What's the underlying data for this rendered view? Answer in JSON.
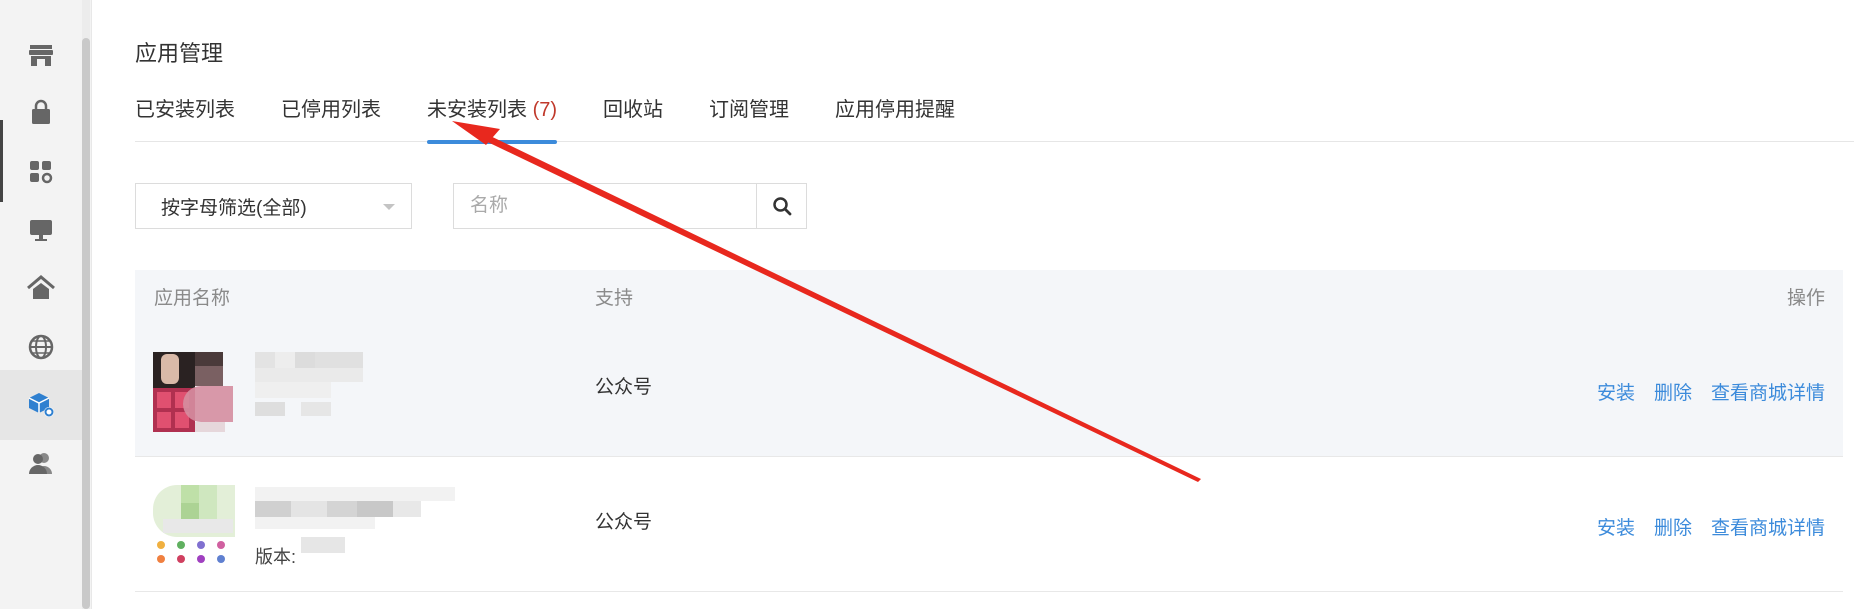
{
  "sidebar": {
    "items": [
      {
        "icon": "store-icon"
      },
      {
        "icon": "shopping-bag-icon"
      },
      {
        "icon": "apps-settings-icon"
      },
      {
        "icon": "monitor-icon"
      },
      {
        "icon": "home-icon"
      },
      {
        "icon": "globe-icon"
      },
      {
        "icon": "app-cube-settings-icon",
        "active": true
      },
      {
        "icon": "users-icon"
      }
    ]
  },
  "page": {
    "title": "应用管理"
  },
  "tabs": [
    {
      "label": "已安装列表",
      "count": ""
    },
    {
      "label": "已停用列表",
      "count": ""
    },
    {
      "label": "未安装列表",
      "count": "(7)",
      "active": true
    },
    {
      "label": "回收站",
      "count": ""
    },
    {
      "label": "订阅管理",
      "count": ""
    },
    {
      "label": "应用停用提醒",
      "count": ""
    }
  ],
  "filters": {
    "letter_filter": "按字母筛选(全部)",
    "search_placeholder": "名称"
  },
  "table": {
    "headers": {
      "name": "应用名称",
      "support": "支持",
      "action": "操作"
    },
    "rows": [
      {
        "support": "公众号",
        "version_label": "",
        "actions": {
          "install": "安装",
          "delete": "删除",
          "detail": "查看商城详情"
        }
      },
      {
        "support": "公众号",
        "version_label": "版本:",
        "actions": {
          "install": "安装",
          "delete": "删除",
          "detail": "查看商城详情"
        }
      }
    ]
  },
  "colors": {
    "accent": "#3c8bdb",
    "count_red": "#c0392b",
    "annotation_arrow": "#e8281e"
  }
}
